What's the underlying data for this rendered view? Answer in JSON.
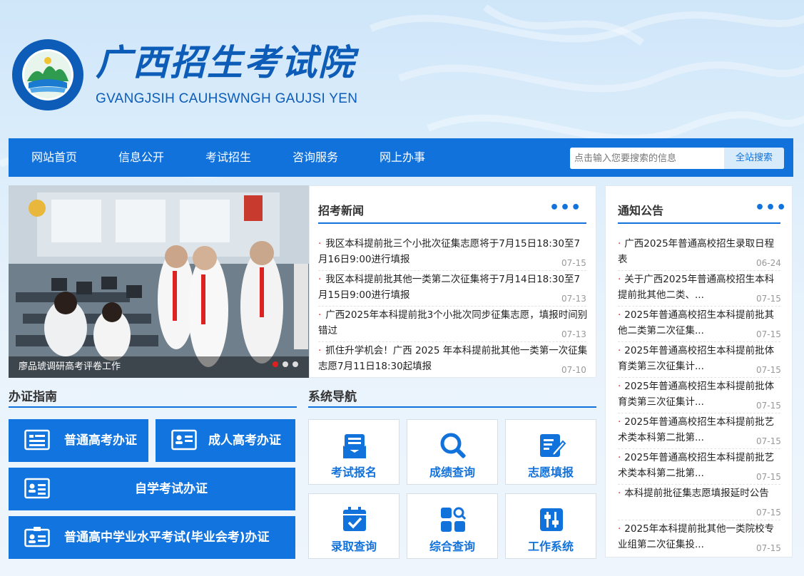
{
  "header": {
    "title": "广西招生考试院",
    "subtitle": "GVANGJSIH CAUHSWNGH GAUJSI YEN"
  },
  "nav": {
    "items": [
      "网站首页",
      "信息公开",
      "考试招生",
      "咨询服务",
      "网上办事"
    ],
    "search_placeholder": "点击输入您要搜索的信息",
    "search_button": "全站搜索"
  },
  "slider": {
    "caption": "廖品琥调研高考评卷工作",
    "slide_count": 3,
    "active_index": 0
  },
  "news": {
    "title": "招考新闻",
    "more": "•••",
    "items": [
      {
        "text": "我区本科提前批三个小批次征集志愿将于7月15日18:30至7月16日9:00进行填报",
        "date": "07-15"
      },
      {
        "text": "我区本科提前批其他一类第二次征集将于7月14日18:30至7月15日9:00进行填报",
        "date": "07-13"
      },
      {
        "text": "广西2025年本科提前批3个小批次同步征集志愿，填报时间别错过",
        "date": "07-13"
      },
      {
        "text": "抓住升学机会！广西 2025 年本科提前批其他一类第一次征集志愿7月11日18:30起填报",
        "date": "07-10"
      }
    ]
  },
  "notices": {
    "title": "通知公告",
    "more": "•••",
    "items": [
      {
        "text": "广西2025年普通高校招生录取日程表",
        "date": "06-24"
      },
      {
        "text": "关于广西2025年普通高校招生本科提前批其他二类、...",
        "date": "07-15"
      },
      {
        "text": "2025年普通高校招生本科提前批其他二类第二次征集...",
        "date": "07-15"
      },
      {
        "text": "2025年普通高校招生本科提前批体育类第三次征集计...",
        "date": "07-15"
      },
      {
        "text": "2025年普通高校招生本科提前批体育类第三次征集计...",
        "date": "07-15"
      },
      {
        "text": "2025年普通高校招生本科提前批艺术类本科第二批第...",
        "date": "07-15"
      },
      {
        "text": "2025年普通高校招生本科提前批艺术类本科第二批第...",
        "date": "07-15"
      },
      {
        "text": "本科提前批征集志愿填报延时公告",
        "date": "07-15"
      },
      {
        "text": "2025年本科提前批其他一类院校专业组第二次征集投...",
        "date": "07-15"
      }
    ]
  },
  "guide": {
    "title": "办证指南",
    "buttons": [
      "普通高考办证",
      "成人高考办证",
      "自学考试办证",
      "普通高中学业水平考试(毕业会考)办证"
    ]
  },
  "system_nav": {
    "title": "系统导航",
    "tiles": [
      {
        "label": "考试报名",
        "icon": "registration-icon"
      },
      {
        "label": "成绩查询",
        "icon": "search-score-icon"
      },
      {
        "label": "志愿填报",
        "icon": "form-edit-icon"
      },
      {
        "label": "录取查询",
        "icon": "calendar-check-icon"
      },
      {
        "label": "综合查询",
        "icon": "grid-search-icon"
      },
      {
        "label": "工作系统",
        "icon": "sliders-icon"
      }
    ]
  },
  "colors": {
    "primary": "#1272dc",
    "bullet": "#dd2222",
    "title_blue": "#0c5cb8"
  }
}
